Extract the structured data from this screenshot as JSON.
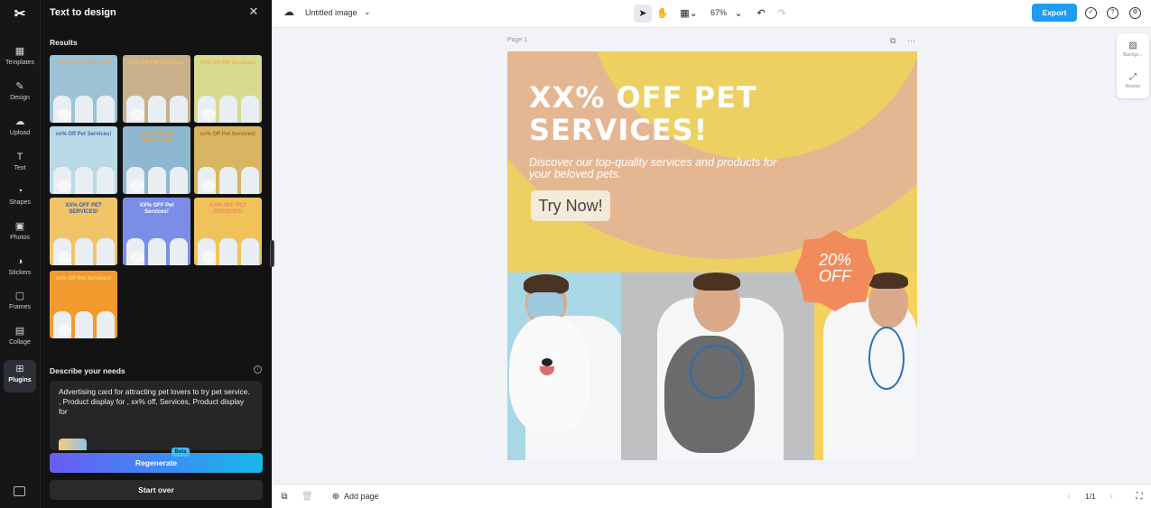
{
  "rail": {
    "items": [
      {
        "label": "Templates",
        "icon": "templates-icon",
        "glyph": "▦"
      },
      {
        "label": "Design",
        "icon": "design-icon",
        "glyph": "✎"
      },
      {
        "label": "Upload",
        "icon": "upload-icon",
        "glyph": "☁"
      },
      {
        "label": "Text",
        "icon": "text-icon",
        "glyph": "T"
      },
      {
        "label": "Shapes",
        "icon": "shapes-icon",
        "glyph": "◔"
      },
      {
        "label": "Photos",
        "icon": "photos-icon",
        "glyph": "▣"
      },
      {
        "label": "Stickers",
        "icon": "stickers-icon",
        "glyph": "◑"
      },
      {
        "label": "Frames",
        "icon": "frames-icon",
        "glyph": "▢"
      },
      {
        "label": "Collage",
        "icon": "collage-icon",
        "glyph": "▤"
      },
      {
        "label": "Plugins",
        "icon": "plugins-icon",
        "glyph": "⊞",
        "active": true
      }
    ]
  },
  "panel": {
    "title": "Text to design",
    "results_label": "Results",
    "thumbnails": [
      {
        "title": "xx% Off Pet Services!",
        "bg": "#9cc3d5",
        "accent": "#f2a35b"
      },
      {
        "title": "xx% Off Pet Services!",
        "bg": "#c8b08a",
        "accent": "#f5c063"
      },
      {
        "title": "xx% Off Pet Services!",
        "bg": "#d9d98f",
        "accent": "#f0b04f"
      },
      {
        "title": "xx% Off Pet Services!",
        "bg": "#b9d9e6",
        "accent": "#3a6ea5"
      },
      {
        "title": "XX% OFF PET SERVICES!",
        "bg": "#8eb8d0",
        "accent": "#e8a24a"
      },
      {
        "title": "xx% Off Pet Services!",
        "bg": "#d8b560",
        "accent": "#a86b2c"
      },
      {
        "title": "XX% OFF PET SERVICES!",
        "bg": "#f1c46a",
        "accent": "#3b5ba8"
      },
      {
        "title": "XX% OFF Pet Services!",
        "bg": "#7a8ee8",
        "accent": "#ffffff"
      },
      {
        "title": "XX% OFF PET SERVICES!",
        "bg": "#f0c35a",
        "accent": "#ea8858"
      },
      {
        "title": "xx% Off Pet Services!",
        "bg": "#f39a2e",
        "accent": "#ffd36b"
      }
    ],
    "needs_label": "Describe your needs",
    "needs_text": "Advertising card for attracting pet lovers to try pet service.\n, Product display for , xx% off, Services, Product display for",
    "regenerate_label": "Regenerate",
    "beta_label": "Beta",
    "start_over_label": "Start over"
  },
  "topbar": {
    "doc_title": "Untitled image",
    "zoom": "67%",
    "export_label": "Export"
  },
  "canvas": {
    "page_label": "Page 1",
    "headline": "XX% OFF PET SERVICES!",
    "subtext": "Discover our top-quality services and products for your beloved pets.",
    "cta": "Try Now!",
    "badge_line1": "20%",
    "badge_line2": "OFF"
  },
  "bottombar": {
    "add_page_label": "Add page",
    "pager": "1/1"
  },
  "right_panel": {
    "items": [
      {
        "label": "Backgr...",
        "icon": "background-icon"
      },
      {
        "label": "Resize",
        "icon": "resize-icon"
      }
    ]
  },
  "colors": {
    "export": "#1f9cf0",
    "artboard_yellow": "#ecd061",
    "artboard_peach": "#e5b692",
    "badge_orange": "#f28b5c"
  }
}
